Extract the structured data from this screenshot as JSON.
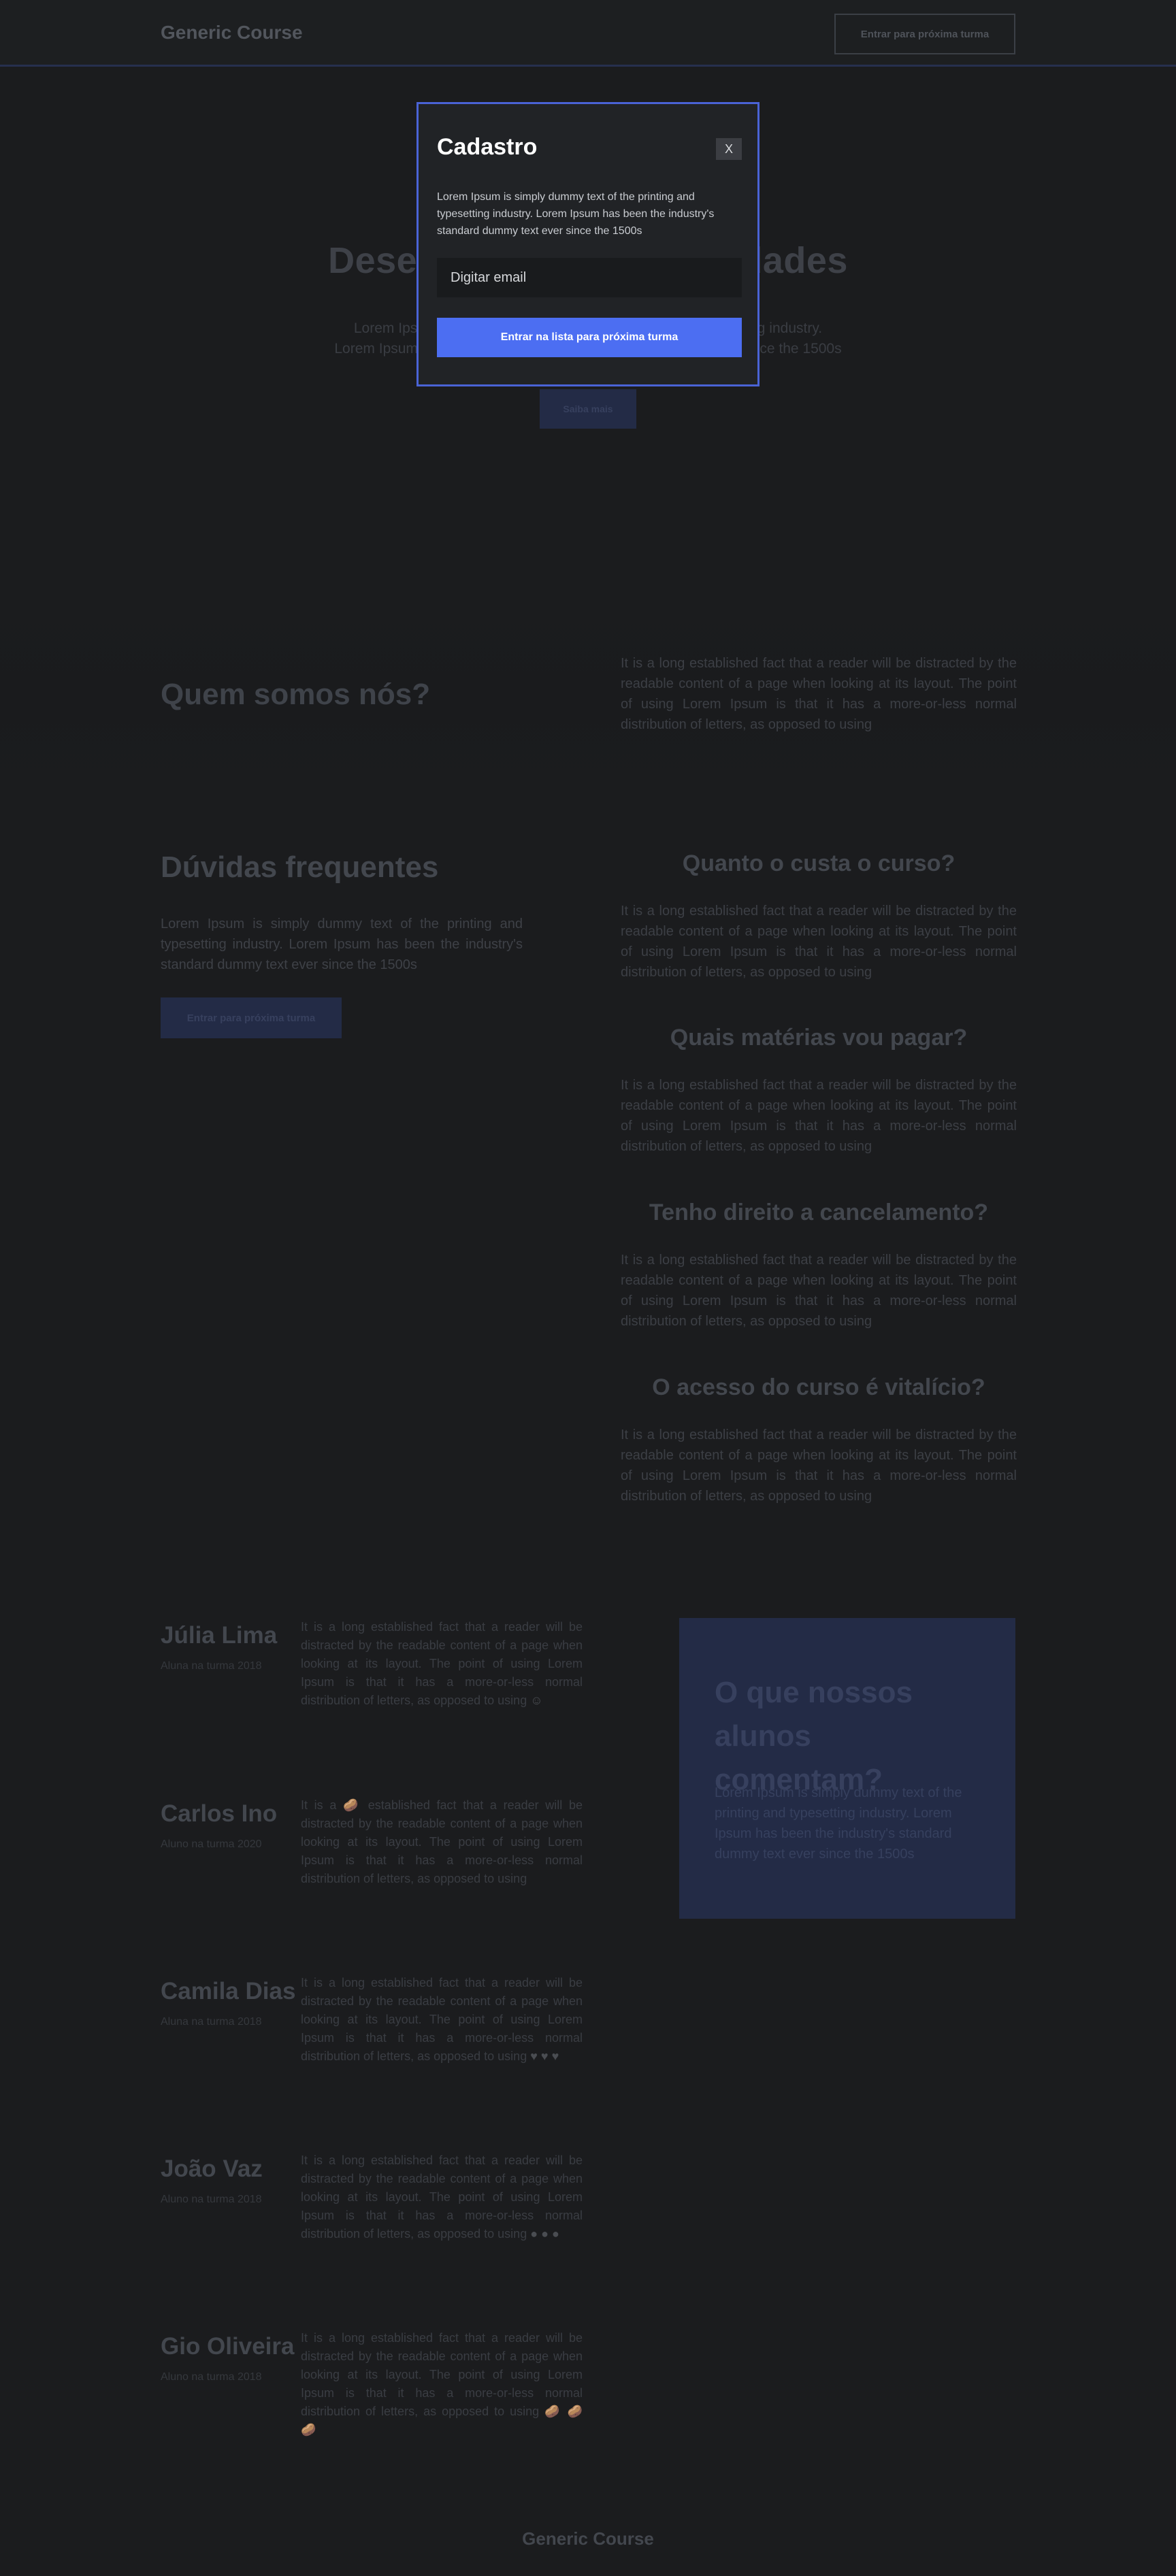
{
  "header": {
    "brand": "Generic Course",
    "cta_label": "Entrar para próxima turma"
  },
  "hero": {
    "title": "Desenvolva suas habilidades",
    "subtitle_line1": "Lorem Ipsum is simply dummy text of the printing and typesetting industry.",
    "subtitle_line2": "Lorem Ipsum has been the industry's standard dummy text ever since the 1500s",
    "button_label": "Saiba mais"
  },
  "about": {
    "title": "Quem somos nós?",
    "text": "It is a long established fact that a reader will be distracted by the readable content of a page when looking at its layout. The point of using Lorem Ipsum is that it has a more-or-less normal distribution of letters, as opposed to using"
  },
  "faq": {
    "title": "Dúvidas frequentes",
    "text": "Lorem Ipsum is simply dummy text of the printing and typesetting industry. Lorem Ipsum has been the industry's standard dummy text ever since the 1500s",
    "button_label": "Entrar para próxima turma",
    "items": [
      {
        "question": "Quanto o custa o curso?",
        "answer": "It is a long established fact that a reader will be distracted by the readable content of a page when looking at its layout. The point of using Lorem Ipsum is that it has a more-or-less normal distribution of letters, as opposed to using"
      },
      {
        "question": "Quais matérias vou pagar?",
        "answer": "It is a long established fact that a reader will be distracted by the readable content of a page when looking at its layout. The point of using Lorem Ipsum is that it has a more-or-less normal distribution of letters, as opposed to using"
      },
      {
        "question": "Tenho direito a cancelamento?",
        "answer": "It is a long established fact that a reader will be distracted by the readable content of a page when looking at its layout. The point of using Lorem Ipsum is that it has a more-or-less normal distribution of letters, as opposed to using"
      },
      {
        "question": "O acesso do curso é vitalício?",
        "answer": "It is a long established fact that a reader will be distracted by the readable content of a page when looking at its layout. The point of using Lorem Ipsum is that it has a more-or-less normal distribution of letters, as opposed to using"
      }
    ]
  },
  "testimonials": {
    "box_title": "O que nossos alunos comentam?",
    "box_text": "Lorem Ipsum is simply dummy text of the printing and typesetting industry. Lorem Ipsum has been the industry's standard dummy text ever since the 1500s",
    "items": [
      {
        "name": "Júlia Lima",
        "role": "Aluna na turma 2018",
        "text_before": "It is a long established fact that a reader will be distracted by the readable content of a page when looking at its layout. The point of using Lorem Ipsum is that it has a more-or-less normal distribution of letters, as opposed to using",
        "text_after": "",
        "emoji": "☺"
      },
      {
        "name": "Carlos Ino",
        "role": "Aluno na turma 2020",
        "text_before": "It is a",
        "text_after": "established fact that a reader will be distracted by the readable content of a page when looking at its layout. The point of using Lorem Ipsum is that it has a more-or-less normal distribution of letters, as opposed to using",
        "emoji": "🥔"
      },
      {
        "name": "Camila Dias",
        "role": "Aluna na turma 2018",
        "text_before": "It is a long established fact that a reader will be distracted by the readable content of a page when looking at its layout. The point of using Lorem Ipsum is that it has a more-or-less normal distribution of letters, as opposed to using",
        "text_after": "",
        "emoji": "♥ ♥ ♥"
      },
      {
        "name": "João Vaz",
        "role": "Aluno na turma 2018",
        "text_before": "It is a long established fact that a reader will be distracted by the readable content of a page when looking at its layout. The point of using Lorem Ipsum is that it has a more-or-less normal distribution of letters, as opposed to using",
        "text_after": "",
        "emoji": "● ● ●"
      },
      {
        "name": "Gio Oliveira",
        "role": "Aluno na turma 2018",
        "text_before": "It is a long established fact that a reader will be distracted by the readable content of a page when looking at its layout. The point of using Lorem Ipsum is that it has a more-or-less normal distribution of letters, as opposed to using",
        "text_after": "",
        "emoji": "🥔 🥔 🥔"
      }
    ]
  },
  "footer": {
    "brand": "Generic Course"
  },
  "modal": {
    "title": "Cadastro",
    "close_label": "X",
    "text": "Lorem Ipsum is simply dummy text of the printing and typesetting industry. Lorem Ipsum has been the industry's standard dummy text ever since the 1500s",
    "email_placeholder": "Digitar email",
    "submit_label": "Entrar na lista para próxima turma"
  },
  "colors": {
    "background": "#1b1c1e",
    "accent": "#4c6ef2",
    "modal_border": "#4a63d6",
    "muted_accent": "#232b46"
  }
}
